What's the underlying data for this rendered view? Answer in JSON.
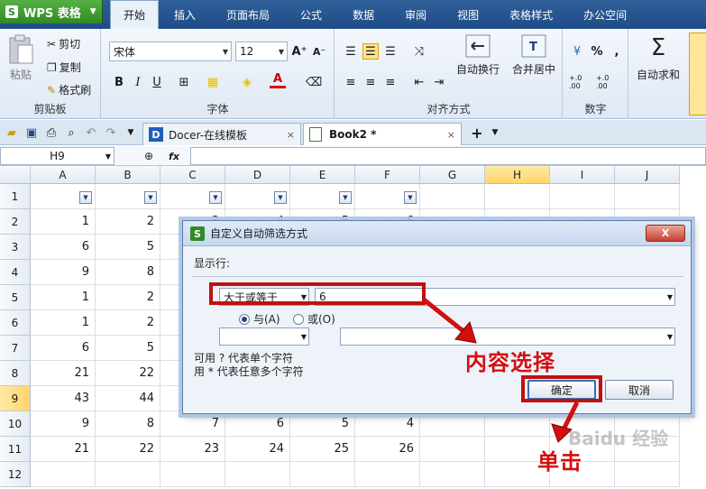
{
  "app": {
    "button_label": "WPS 表格",
    "logo": "S",
    "menu_tabs": [
      "开始",
      "插入",
      "页面布局",
      "公式",
      "数据",
      "审阅",
      "视图",
      "表格样式",
      "办公空间"
    ],
    "active_tab": "开始"
  },
  "ribbon": {
    "clipboard": {
      "paste": "粘贴",
      "cut": "剪切",
      "copy": "复制",
      "format_painter": "格式刷",
      "group": "剪贴板"
    },
    "font": {
      "name": "宋体",
      "size": "12",
      "bold": "B",
      "italic": "I",
      "underline": "U",
      "font_color_letter": "A",
      "grow": "A⁺",
      "shrink": "A⁻",
      "group": "字体"
    },
    "align": {
      "wrap": "自动换行",
      "merge": "合并居中",
      "group": "对齐方式"
    },
    "number": {
      "percent": "%",
      "thousands": ",",
      "inc_decimal": "+.0 .00",
      "dec_decimal": "+.0 .00",
      "group": "数字"
    },
    "editing": {
      "autosum": "自动求和",
      "autosum_icon": "Σ"
    }
  },
  "doc_tabs": [
    {
      "label": "Docer-在线模板",
      "close": "×"
    },
    {
      "label": "Book2 *",
      "close": "×"
    }
  ],
  "formula_bar": {
    "cell_ref": "H9",
    "fx": "fx"
  },
  "grid": {
    "columns": [
      "A",
      "B",
      "C",
      "D",
      "E",
      "F",
      "G",
      "H",
      "I",
      "J"
    ],
    "rows": [
      "1",
      "2",
      "3",
      "4",
      "5",
      "6",
      "7",
      "8",
      "9",
      "10",
      "11",
      "12"
    ],
    "selected_col": "H",
    "selected_row": "9",
    "cells": [
      [
        "",
        "",
        "",
        "",
        "",
        ""
      ],
      [
        "1",
        "2",
        "3",
        "4",
        "5",
        "6"
      ],
      [
        "6",
        "5",
        "",
        "",
        "",
        ""
      ],
      [
        "9",
        "8",
        "",
        "",
        "",
        ""
      ],
      [
        "1",
        "2",
        "",
        "",
        "",
        ""
      ],
      [
        "1",
        "2",
        "",
        "",
        "",
        ""
      ],
      [
        "6",
        "5",
        "",
        "",
        "",
        ""
      ],
      [
        "21",
        "22",
        "",
        "",
        "",
        ""
      ],
      [
        "43",
        "44",
        "",
        "",
        "",
        ""
      ],
      [
        "9",
        "8",
        "7",
        "6",
        "5",
        "4"
      ],
      [
        "21",
        "22",
        "23",
        "24",
        "25",
        "26"
      ],
      [
        "",
        "",
        "",
        "",
        "",
        ""
      ]
    ]
  },
  "dialog": {
    "icon": "S",
    "title": "自定义自动筛选方式",
    "close": "X",
    "show_rows_label": "显示行:",
    "condition1_operator": "大于或等于",
    "condition1_value": "6",
    "and_label": "与(A)",
    "or_label": "或(O)",
    "condition2_operator": "",
    "condition2_value": "",
    "hint1": "可用 ? 代表单个字符",
    "hint2": "用 * 代表任意多个字符",
    "ok": "确定",
    "cancel": "取消"
  },
  "annotations": {
    "select_content": "内容选择",
    "click": "单击",
    "watermark": "Baidu 经验",
    "color": "#d40f0f"
  }
}
